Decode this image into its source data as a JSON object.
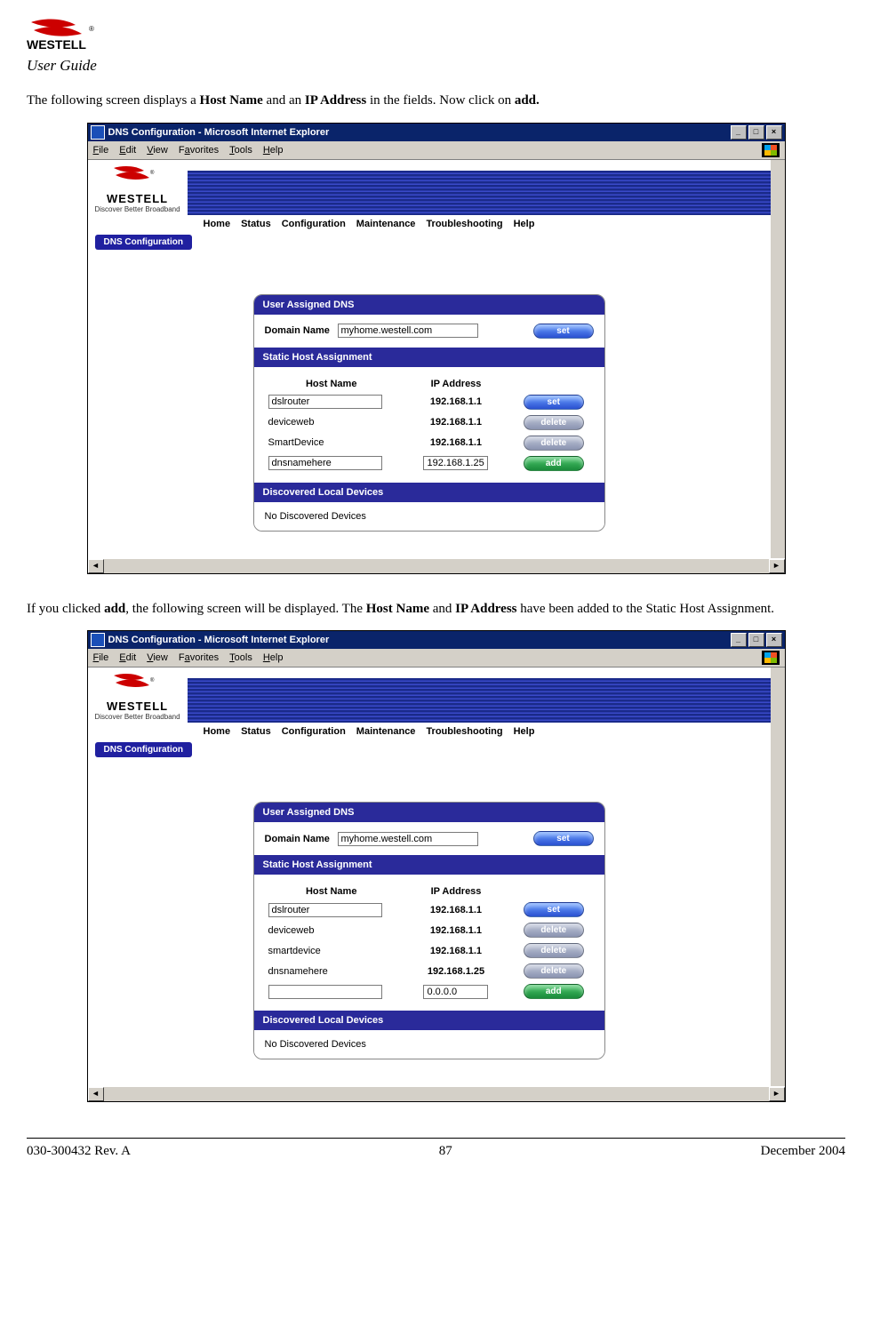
{
  "header": {
    "brand_line1": "WESTELL",
    "user_guide": "User Guide"
  },
  "para1_prefix": "The following screen displays a ",
  "para1_b1": "Host Name",
  "para1_mid1": " and an ",
  "para1_b2": "IP Address",
  "para1_mid2": " in the fields. Now click on ",
  "para1_b3": "add.",
  "para2_prefix": "If you clicked ",
  "para2_b1": "add",
  "para2_mid1": ", the following screen will be displayed. The ",
  "para2_b2": "Host Name",
  "para2_mid2": " and ",
  "para2_b3": "IP Address",
  "para2_end": " have been added to the Static Host Assignment.",
  "ie": {
    "title": "DNS Configuration - Microsoft Internet Explorer",
    "menus": {
      "file": "File",
      "edit": "Edit",
      "view": "View",
      "favorites": "Favorites",
      "tools": "Tools",
      "help": "Help"
    },
    "westell": {
      "name": "WESTELL",
      "tagline": "Discover Better Broadband"
    },
    "nav": {
      "home": "Home",
      "status": "Status",
      "configuration": "Configuration",
      "maintenance": "Maintenance",
      "troubleshooting": "Troubleshooting",
      "help": "Help"
    },
    "subtab": "DNS Configuration"
  },
  "panel": {
    "hdr_user_dns": "User Assigned DNS",
    "hdr_static": "Static Host Assignment",
    "hdr_discovered": "Discovered Local Devices",
    "domain_label": "Domain Name",
    "domain_value": "myhome.westell.com",
    "col_host": "Host Name",
    "col_ip": "IP Address",
    "no_devices": "No Discovered Devices",
    "btn_set": "set",
    "btn_delete": "delete",
    "btn_add": "add"
  },
  "shot1": {
    "rows": [
      {
        "host": "dslrouter",
        "host_input": true,
        "ip": "192.168.1.1",
        "ip_input": false,
        "btn": "set",
        "btn_color": "blue"
      },
      {
        "host": "deviceweb",
        "host_input": false,
        "ip": "192.168.1.1",
        "ip_input": false,
        "btn": "delete",
        "btn_color": "grey"
      },
      {
        "host": "SmartDevice",
        "host_input": false,
        "ip": "192.168.1.1",
        "ip_input": false,
        "btn": "delete",
        "btn_color": "grey"
      },
      {
        "host": "dnsnamehere",
        "host_input": true,
        "ip": "192.168.1.25",
        "ip_input": true,
        "btn": "add",
        "btn_color": "green"
      }
    ]
  },
  "shot2": {
    "rows": [
      {
        "host": "dslrouter",
        "host_input": true,
        "ip": "192.168.1.1",
        "ip_input": false,
        "btn": "set",
        "btn_color": "blue"
      },
      {
        "host": "deviceweb",
        "host_input": false,
        "ip": "192.168.1.1",
        "ip_input": false,
        "btn": "delete",
        "btn_color": "grey"
      },
      {
        "host": "smartdevice",
        "host_input": false,
        "ip": "192.168.1.1",
        "ip_input": false,
        "btn": "delete",
        "btn_color": "grey"
      },
      {
        "host": "dnsnamehere",
        "host_input": false,
        "ip": "192.168.1.25",
        "ip_input": false,
        "btn": "delete",
        "btn_color": "grey"
      },
      {
        "host": "",
        "host_input": true,
        "ip": "0.0.0.0",
        "ip_input": true,
        "btn": "add",
        "btn_color": "green"
      }
    ]
  },
  "footer": {
    "left": "030-300432 Rev. A",
    "center": "87",
    "right": "December 2004"
  }
}
